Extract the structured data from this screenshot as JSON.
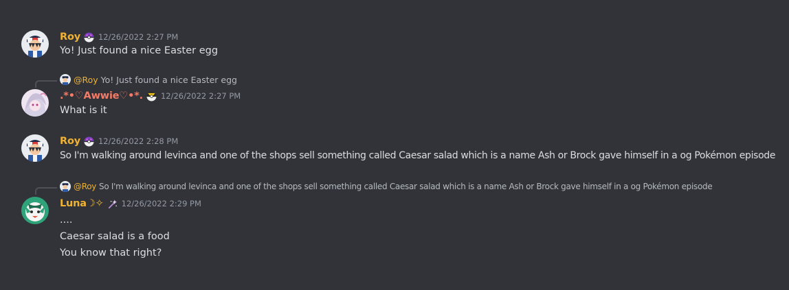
{
  "colors": {
    "background": "#313338",
    "roy": "#f0b232",
    "awwie": "#f47b67",
    "luna": "#f0b232",
    "timestamp": "#949ba4",
    "text": "#dbdee1"
  },
  "messages": [
    {
      "username": "Roy",
      "badge": "masterball-badge",
      "timestamp": "12/26/2022 2:27 PM",
      "lines": [
        "Yo! Just found a nice Easter egg"
      ]
    },
    {
      "reply": {
        "mention": "@Roy",
        "text": "Yo! Just found a nice Easter egg"
      },
      "username": ".*•♡Awwie♡•*.",
      "badge": "ultraball-badge",
      "timestamp": "12/26/2022 2:27 PM",
      "lines": [
        "What is it"
      ]
    },
    {
      "username": "Roy",
      "badge": "masterball-badge",
      "timestamp": "12/26/2022 2:28 PM",
      "lines": [
        "So I'm walking around levinca and one of the shops sell something called Caesar salad which is a name Ash or Brock gave himself in a og Pokémon episode"
      ]
    },
    {
      "reply": {
        "mention": "@Roy",
        "text": "So I'm walking around levinca and one of the shops sell something called Caesar salad which is a name Ash or Brock gave himself in a og Pokémon episode"
      },
      "username": "Luna☽✧",
      "badge": "wand-badge",
      "timestamp": "12/26/2022 2:29 PM",
      "lines": [
        "....",
        "Caesar salad is a food",
        "You know that right?"
      ]
    }
  ]
}
